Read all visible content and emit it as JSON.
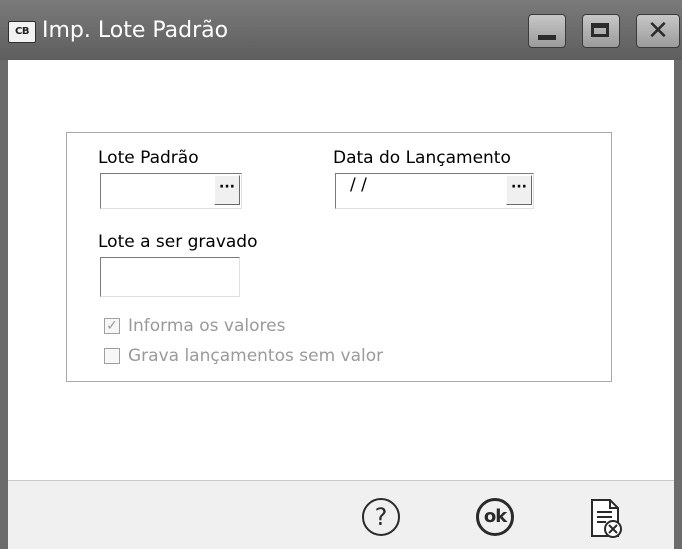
{
  "window": {
    "title": "Imp. Lote Padrão",
    "app_icon_text": "CB",
    "controls": [
      "minimize-icon",
      "maximize-icon",
      "close-icon"
    ]
  },
  "form": {
    "lote_padrao_label": "Lote Padrão",
    "lote_padrao_value": "",
    "data_lancamento_label": "Data do Lançamento",
    "data_lancamento_value": " /  /",
    "lote_gravado_label": "Lote a ser gravado",
    "lote_gravado_value": "",
    "lookup_button_label": "···"
  },
  "options": [
    {
      "label": "Informa os valores",
      "checked": true,
      "enabled": false
    },
    {
      "label": "Grava lançamentos sem valor",
      "checked": false,
      "enabled": false
    }
  ],
  "footer": {
    "help_text": "?",
    "ok_text": "ok",
    "buttons": [
      "help-icon",
      "ok-icon",
      "cancel-document-icon"
    ]
  },
  "colors": {
    "titlebar": "#6b6b6b",
    "window_bg": "#ffffff",
    "footer_bg": "#f0f0f0",
    "disabled_text": "#9a9a9a"
  }
}
